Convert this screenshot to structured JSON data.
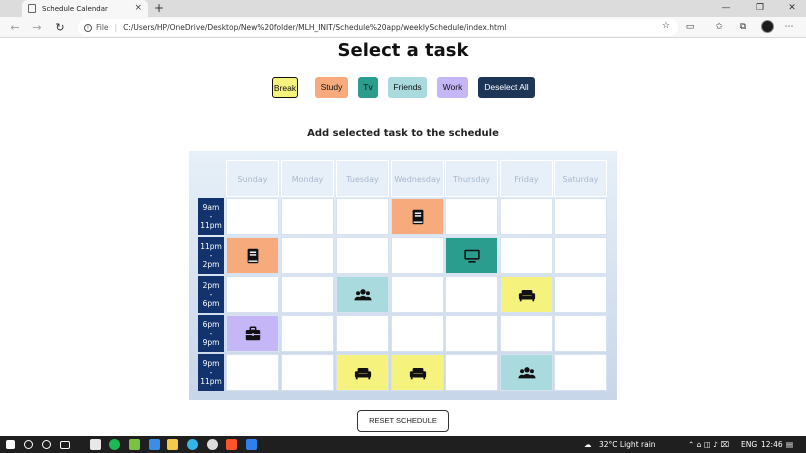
{
  "browser": {
    "tab_title": "Schedule Calendar",
    "tab_close": "×",
    "new_tab": "+",
    "address_prefix": "File",
    "address_sep": "|",
    "url": "C:/Users/HP/OneDrive/Desktop/New%20folder/MLH_INIT/Schedule%20app/weeklySchedule/index.html",
    "minimize": "—",
    "maximize": "❐",
    "close": "✕"
  },
  "page": {
    "title": "Select a task",
    "subtitle": "Add selected task to the schedule",
    "reset_label": "RESET SCHEDULE"
  },
  "tasks": [
    {
      "label": "Break",
      "color": "#f6f27e",
      "selected": true
    },
    {
      "label": "Study",
      "color": "#f7ab7d",
      "selected": false
    },
    {
      "label": "Tv",
      "color": "#2a9d8f",
      "selected": false
    },
    {
      "label": "Friends",
      "color": "#a9dade",
      "selected": false
    },
    {
      "label": "Work",
      "color": "#c5b7f7",
      "selected": false
    },
    {
      "label": "Deselect All",
      "color": "#1d3557",
      "selected": false
    }
  ],
  "days": [
    "Sunday",
    "Monday",
    "Tuesday",
    "Wednesday",
    "Thursday",
    "Friday",
    "Saturday"
  ],
  "time_slots": [
    {
      "start": "9am",
      "dash": "-",
      "end": "11pm"
    },
    {
      "start": "11pm",
      "dash": "-",
      "end": "2pm"
    },
    {
      "start": "2pm",
      "dash": "-",
      "end": "6pm"
    },
    {
      "start": "6pm",
      "dash": "-",
      "end": "9pm"
    },
    {
      "start": "9pm",
      "dash": "-",
      "end": "11pm"
    }
  ],
  "assignments": [
    [
      "",
      "",
      "",
      "study",
      "",
      "",
      ""
    ],
    [
      "study",
      "",
      "",
      "",
      "tv",
      "",
      ""
    ],
    [
      "",
      "",
      "friends",
      "",
      "",
      "break",
      ""
    ],
    [
      "work",
      "",
      "",
      "",
      "",
      "",
      ""
    ],
    [
      "",
      "",
      "break",
      "break",
      "",
      "friends",
      ""
    ]
  ],
  "task_colors": {
    "break": "#f6f27e",
    "study": "#f7ab7d",
    "tv": "#2a9d8f",
    "friends": "#a9dade",
    "work": "#c5b7f7"
  },
  "task_icons": {
    "break": "couch-icon",
    "study": "book-icon",
    "tv": "tv-icon",
    "friends": "users-icon",
    "work": "briefcase-icon"
  },
  "taskbar": {
    "weather": "32°C  Light rain",
    "lang": "ENG",
    "time": "12:46"
  }
}
